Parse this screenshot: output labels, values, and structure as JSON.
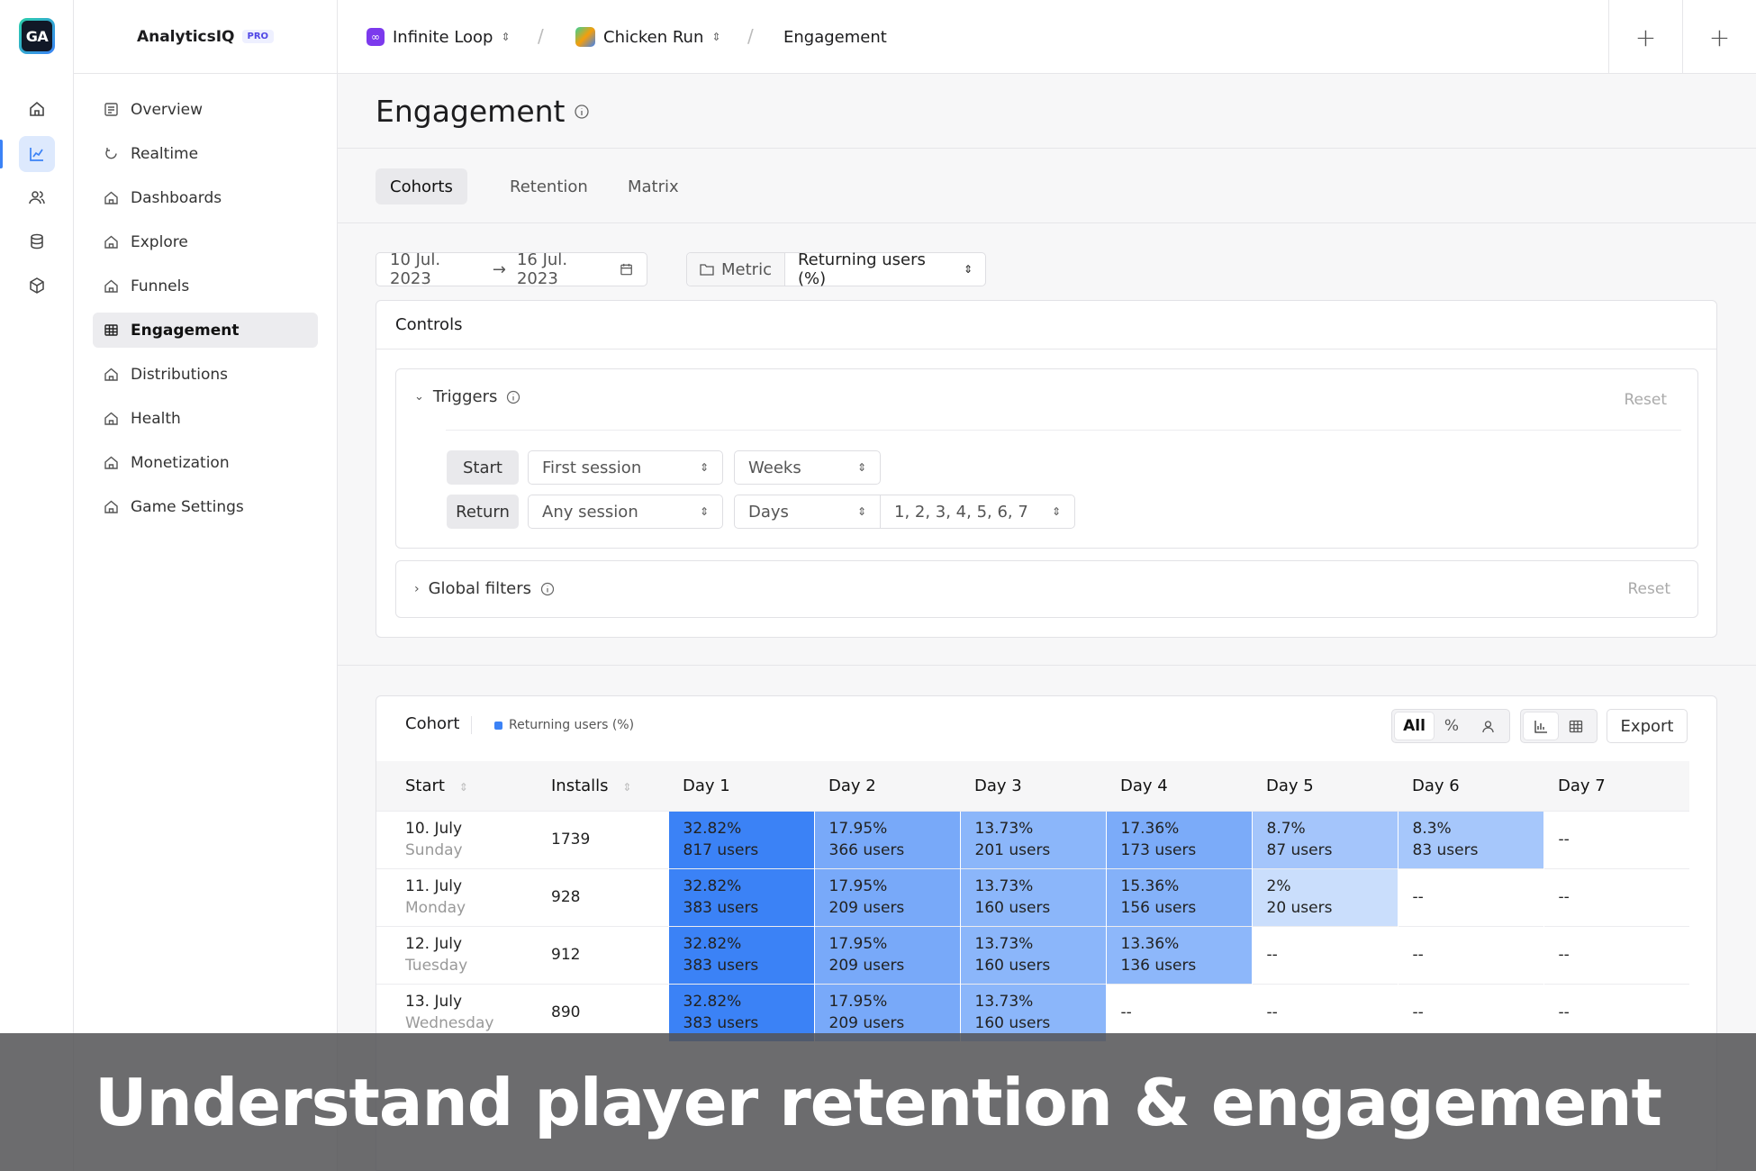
{
  "app": {
    "logo_text": "GA",
    "name": "AnalyticsIQ",
    "plan_badge": "PRO"
  },
  "breadcrumb": [
    {
      "label": "Infinite Loop",
      "icon": "infinity-icon"
    },
    {
      "label": "Chicken Run",
      "icon": "game-thumbnail"
    },
    {
      "label": "Engagement"
    }
  ],
  "sidebar": {
    "items": [
      {
        "label": "Overview",
        "icon": "overview-icon"
      },
      {
        "label": "Realtime",
        "icon": "refresh-icon"
      },
      {
        "label": "Dashboards",
        "icon": "home-icon"
      },
      {
        "label": "Explore",
        "icon": "home-icon"
      },
      {
        "label": "Funnels",
        "icon": "home-icon"
      },
      {
        "label": "Engagement",
        "icon": "grid-icon",
        "active": true
      },
      {
        "label": "Distributions",
        "icon": "home-icon"
      },
      {
        "label": "Health",
        "icon": "home-icon"
      },
      {
        "label": "Monetization",
        "icon": "home-icon"
      },
      {
        "label": "Game Settings",
        "icon": "home-icon"
      }
    ]
  },
  "page": {
    "title": "Engagement"
  },
  "tabs": [
    "Cohorts",
    "Retention",
    "Matrix"
  ],
  "filters": {
    "date_start": "10 Jul. 2023",
    "date_arrow": "→",
    "date_end": "16 Jul. 2023",
    "metric_label": "Metric",
    "metric_value": "Returning users (%)"
  },
  "controls": {
    "title": "Controls",
    "triggers": {
      "title": "Triggers",
      "reset": "Reset",
      "start_label": "Start",
      "start_event": "First session",
      "start_period": "Weeks",
      "return_label": "Return",
      "return_event": "Any session",
      "return_period": "Days",
      "return_days": "1, 2, 3, 4, 5, 6, 7"
    },
    "global_filters": {
      "title": "Global filters",
      "reset": "Reset"
    }
  },
  "cohort_table": {
    "title": "Cohort",
    "legend": "Returning users (%)",
    "accent": "#3b82f6",
    "view_all": "All",
    "view_percent": "%",
    "export": "Export",
    "headers": [
      "Start",
      "Installs",
      "Day 1",
      "Day 2",
      "Day 3",
      "Day 4",
      "Day 5",
      "Day 6",
      "Day 7"
    ],
    "rows": [
      {
        "date": "10. July",
        "weekday": "Sunday",
        "installs": "1739",
        "cells": [
          {
            "pct": "32.82%",
            "users": "817 users",
            "value": 32.82
          },
          {
            "pct": "17.95%",
            "users": "366 users",
            "value": 17.95
          },
          {
            "pct": "13.73%",
            "users": "201 users",
            "value": 13.73
          },
          {
            "pct": "17.36%",
            "users": "173 users",
            "value": 17.36
          },
          {
            "pct": "8.7%",
            "users": "87 users",
            "value": 8.7
          },
          {
            "pct": "8.3%",
            "users": "83 users",
            "value": 8.3
          },
          {
            "pct": "--",
            "users": "",
            "value": null
          }
        ]
      },
      {
        "date": "11. July",
        "weekday": "Monday",
        "installs": "928",
        "cells": [
          {
            "pct": "32.82%",
            "users": "383 users",
            "value": 32.82
          },
          {
            "pct": "17.95%",
            "users": "209 users",
            "value": 17.95
          },
          {
            "pct": "13.73%",
            "users": "160 users",
            "value": 13.73
          },
          {
            "pct": "15.36%",
            "users": "156 users",
            "value": 15.36
          },
          {
            "pct": "2%",
            "users": "20 users",
            "value": 2
          },
          {
            "pct": "--",
            "users": "",
            "value": null
          },
          {
            "pct": "--",
            "users": "",
            "value": null
          }
        ]
      },
      {
        "date": "12. July",
        "weekday": "Tuesday",
        "installs": "912",
        "cells": [
          {
            "pct": "32.82%",
            "users": "383 users",
            "value": 32.82
          },
          {
            "pct": "17.95%",
            "users": "209 users",
            "value": 17.95
          },
          {
            "pct": "13.73%",
            "users": "160 users",
            "value": 13.73
          },
          {
            "pct": "13.36%",
            "users": "136 users",
            "value": 13.36
          },
          {
            "pct": "--",
            "users": "",
            "value": null
          },
          {
            "pct": "--",
            "users": "",
            "value": null
          },
          {
            "pct": "--",
            "users": "",
            "value": null
          }
        ]
      },
      {
        "date": "13. July",
        "weekday": "Wednesday",
        "installs": "890",
        "cells": [
          {
            "pct": "32.82%",
            "users": "383 users",
            "value": 32.82
          },
          {
            "pct": "17.95%",
            "users": "209 users",
            "value": 17.95
          },
          {
            "pct": "13.73%",
            "users": "160 users",
            "value": 13.73
          },
          {
            "pct": "--",
            "users": "",
            "value": null
          },
          {
            "pct": "--",
            "users": "",
            "value": null
          },
          {
            "pct": "--",
            "users": "",
            "value": null
          },
          {
            "pct": "--",
            "users": "",
            "value": null
          }
        ]
      }
    ]
  },
  "banner": {
    "text": "Understand player retention & engagement"
  }
}
